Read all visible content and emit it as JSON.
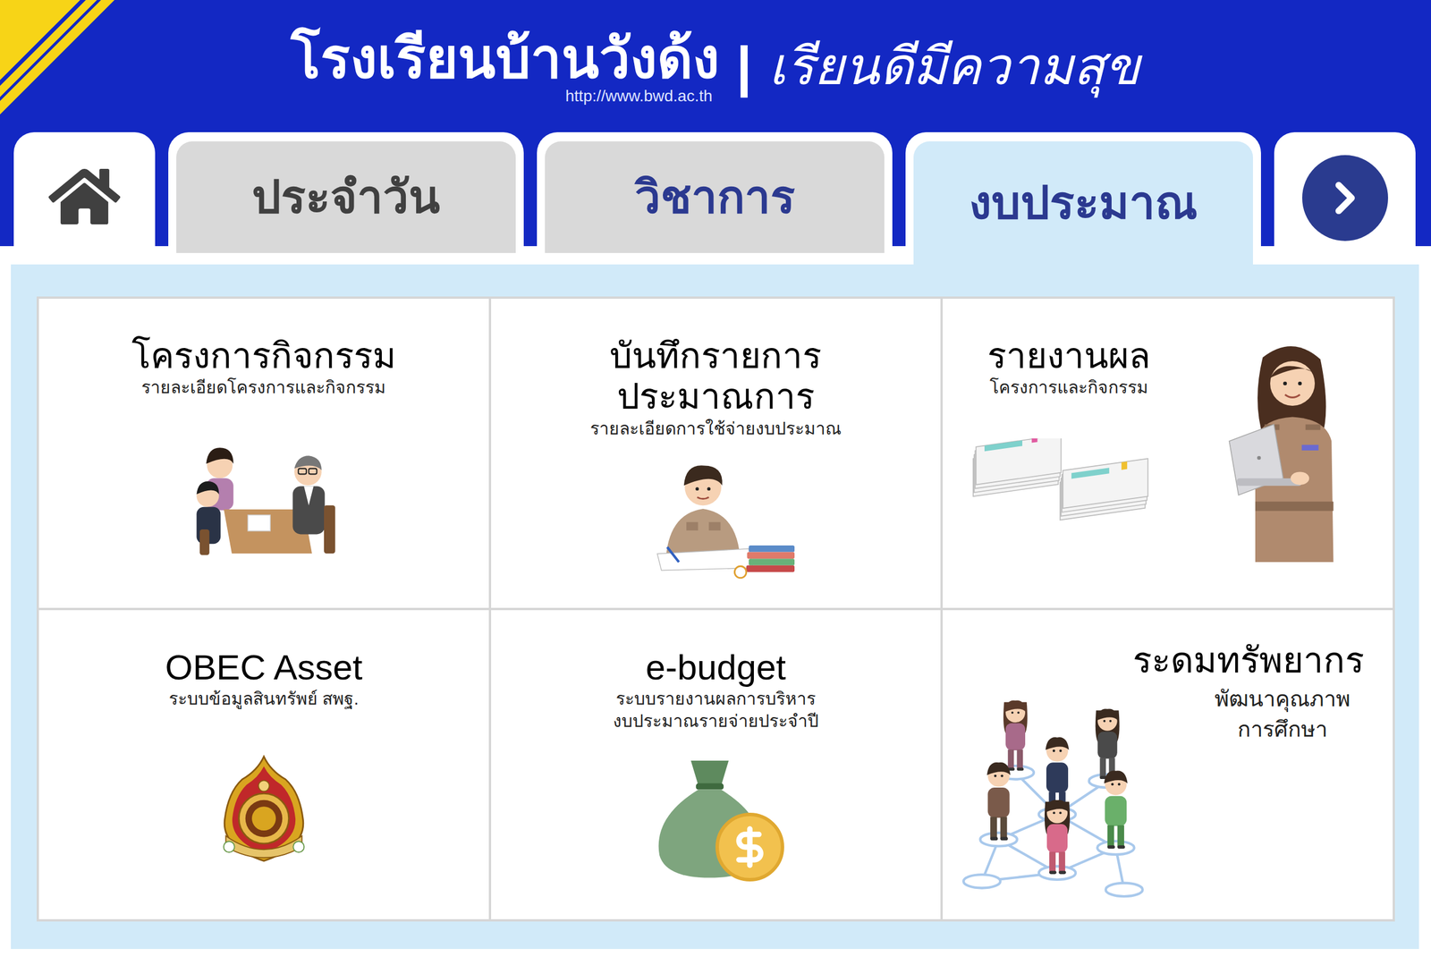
{
  "header": {
    "school_name": "โรงเรียนบ้านวังด้ง",
    "separator": "|",
    "slogan": "เรียนดีมีความสุข",
    "url": "http://www.bwd.ac.th"
  },
  "tabs": [
    {
      "label": "ประจำวัน",
      "selected": false,
      "color": "#404040"
    },
    {
      "label": "วิชาการ",
      "selected": false,
      "color": "#2b3990"
    },
    {
      "label": "งบประมาณ",
      "selected": true,
      "color": "#2b3990"
    }
  ],
  "cards": [
    {
      "kind": "image-below",
      "title_lines": [
        "โครงการกิจกรรม"
      ],
      "subtitle_lines": [
        "รายละเอียดโครงการและกิจกรรม"
      ]
    },
    {
      "kind": "image-below",
      "title_lines": [
        "บันทึกรายการ",
        "ประมาณการ"
      ],
      "subtitle_lines": [
        "รายละเอียดการใช้จ่ายงบประมาณ"
      ]
    },
    {
      "kind": "image-right",
      "title_lines": [
        "รายงานผล"
      ],
      "subtitle_lines": [
        "โครงการและกิจกรรม"
      ]
    },
    {
      "kind": "image-below",
      "title_lines": [
        "OBEC Asset"
      ],
      "subtitle_lines": [
        "ระบบข้อมูลสินทรัพย์ สพฐ."
      ]
    },
    {
      "kind": "image-below",
      "title_lines": [
        "e-budget"
      ],
      "subtitle_lines": [
        "ระบบรายงานผลการบริหาร",
        "งบประมาณรายจ่ายประจำปี"
      ]
    },
    {
      "kind": "image-left",
      "title_lines": [
        "ระดมทรัพยากร"
      ],
      "subtitle_lines": [
        "พัฒนาคุณภาพ",
        "การศึกษา"
      ]
    }
  ]
}
